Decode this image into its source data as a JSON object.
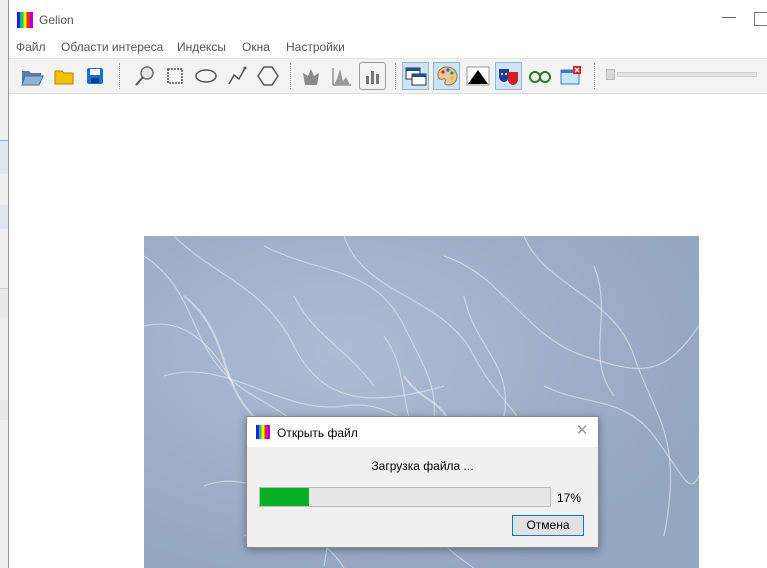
{
  "window": {
    "title": "Gelion"
  },
  "menu": [
    "Файл",
    "Области интереса",
    "Индексы",
    "Окна",
    "Настройки"
  ],
  "toolbar": {
    "groups": [
      [
        "open-folder-icon",
        "folder-icon",
        "save-icon"
      ],
      [
        "pin-icon",
        "rectangle-select-icon",
        "ellipse-select-icon",
        "polyline-icon",
        "polygon-icon"
      ],
      [
        "fill-icon",
        "histogram-icon",
        "bar-chart-icon"
      ],
      [
        "windows-icon",
        "palette-icon",
        "contrast-icon",
        "masks-icon",
        "glasses-icon",
        "close-window-icon"
      ]
    ],
    "slider_level": 0
  },
  "dialog": {
    "title": "Открыть файл",
    "message": "Загрузка файла ...",
    "progress_text": "17%",
    "progress_value": 0.17,
    "cancel_label": "Отмена",
    "colors": {
      "progress": "#06b025",
      "accent": "#0078d7"
    }
  }
}
